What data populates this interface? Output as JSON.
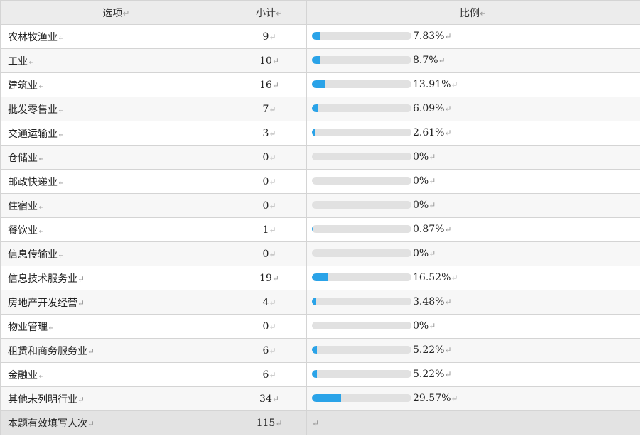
{
  "header": {
    "option": "选项",
    "count": "小计",
    "ratio": "比例"
  },
  "return_mark": "↵",
  "colors": {
    "bar_fill": "#2aa3e8",
    "bar_track": "#e1e1e1",
    "header_bg": "#ececec"
  },
  "rows": [
    {
      "option": "农林牧渔业",
      "count": "9",
      "percent": "7.83%",
      "ratio": 0.0783
    },
    {
      "option": "工业",
      "count": "10",
      "percent": "8.7%",
      "ratio": 0.087
    },
    {
      "option": "建筑业",
      "count": "16",
      "percent": "13.91%",
      "ratio": 0.1391
    },
    {
      "option": "批发零售业",
      "count": "7",
      "percent": "6.09%",
      "ratio": 0.0609
    },
    {
      "option": "交通运输业",
      "count": "3",
      "percent": "2.61%",
      "ratio": 0.0261
    },
    {
      "option": "仓储业",
      "count": "0",
      "percent": "0%",
      "ratio": 0
    },
    {
      "option": "邮政快递业",
      "count": "0",
      "percent": "0%",
      "ratio": 0
    },
    {
      "option": "住宿业",
      "count": "0",
      "percent": "0%",
      "ratio": 0
    },
    {
      "option": "餐饮业",
      "count": "1",
      "percent": "0.87%",
      "ratio": 0.0087
    },
    {
      "option": "信息传输业",
      "count": "0",
      "percent": "0%",
      "ratio": 0
    },
    {
      "option": "信息技术服务业",
      "count": "19",
      "percent": "16.52%",
      "ratio": 0.1652
    },
    {
      "option": "房地产开发经营",
      "count": "4",
      "percent": "3.48%",
      "ratio": 0.0348
    },
    {
      "option": "物业管理",
      "count": "0",
      "percent": "0%",
      "ratio": 0
    },
    {
      "option": "租赁和商务服务业",
      "count": "6",
      "percent": "5.22%",
      "ratio": 0.0522
    },
    {
      "option": "金融业",
      "count": "6",
      "percent": "5.22%",
      "ratio": 0.0522
    },
    {
      "option": "其他未列明行业",
      "count": "34",
      "percent": "29.57%",
      "ratio": 0.2957
    }
  ],
  "footer": {
    "label": "本题有效填写人次",
    "count": "115"
  }
}
